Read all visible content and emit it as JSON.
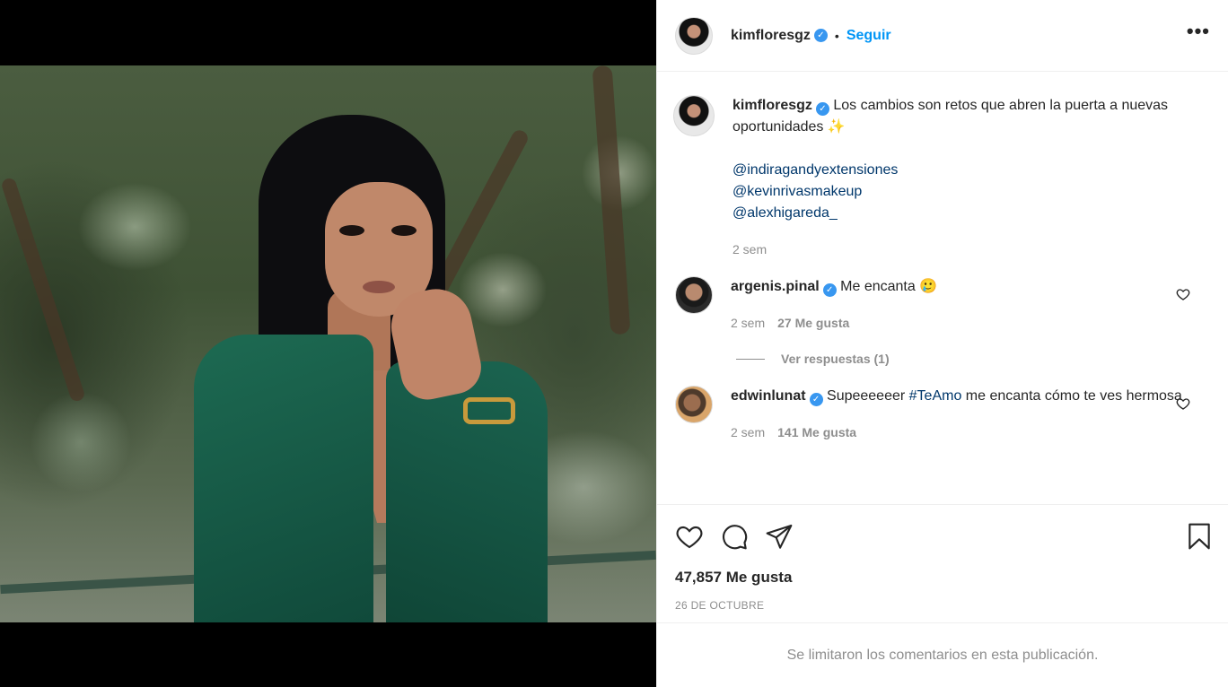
{
  "post": {
    "author": "kimfloresgz",
    "verified_mark": "✓",
    "separator": "•",
    "follow_label": "Seguir",
    "more_label": "•••",
    "caption": {
      "text": "Los cambios son retos que abren la puerta a nuevas oportunidades ✨",
      "mentions": [
        "@indiragandyextensiones",
        "@kevinrivasmakeup",
        "@alexhigareda_"
      ],
      "time": "2 sem"
    },
    "comments": [
      {
        "user": "argenis.pinal",
        "text": "Me encanta 🥲",
        "time": "2 sem",
        "likes": "27 Me gusta",
        "replies_label": "Ver respuestas (1)"
      },
      {
        "user": "edwinlunat",
        "text_before": "Supeeeeeer ",
        "hashtag": "#TeAmo",
        "text_after": " me encanta cómo te ves hermosa",
        "time": "2 sem",
        "likes": "141 Me gusta"
      }
    ],
    "like_count": "47,857 Me gusta",
    "date": "26 DE OCTUBRE",
    "limited_notice": "Se limitaron los comentarios en esta publicación."
  },
  "icons": {
    "like": "heart-icon",
    "comment": "comment-icon",
    "share": "share-icon",
    "save": "bookmark-icon",
    "comment_like": "heart-icon",
    "more": "more-icon",
    "verified": "verified-badge-icon"
  },
  "colors": {
    "link": "#0095f6",
    "mention": "#00376b",
    "verified": "#3897f0",
    "muted": "#8e8e8e"
  }
}
